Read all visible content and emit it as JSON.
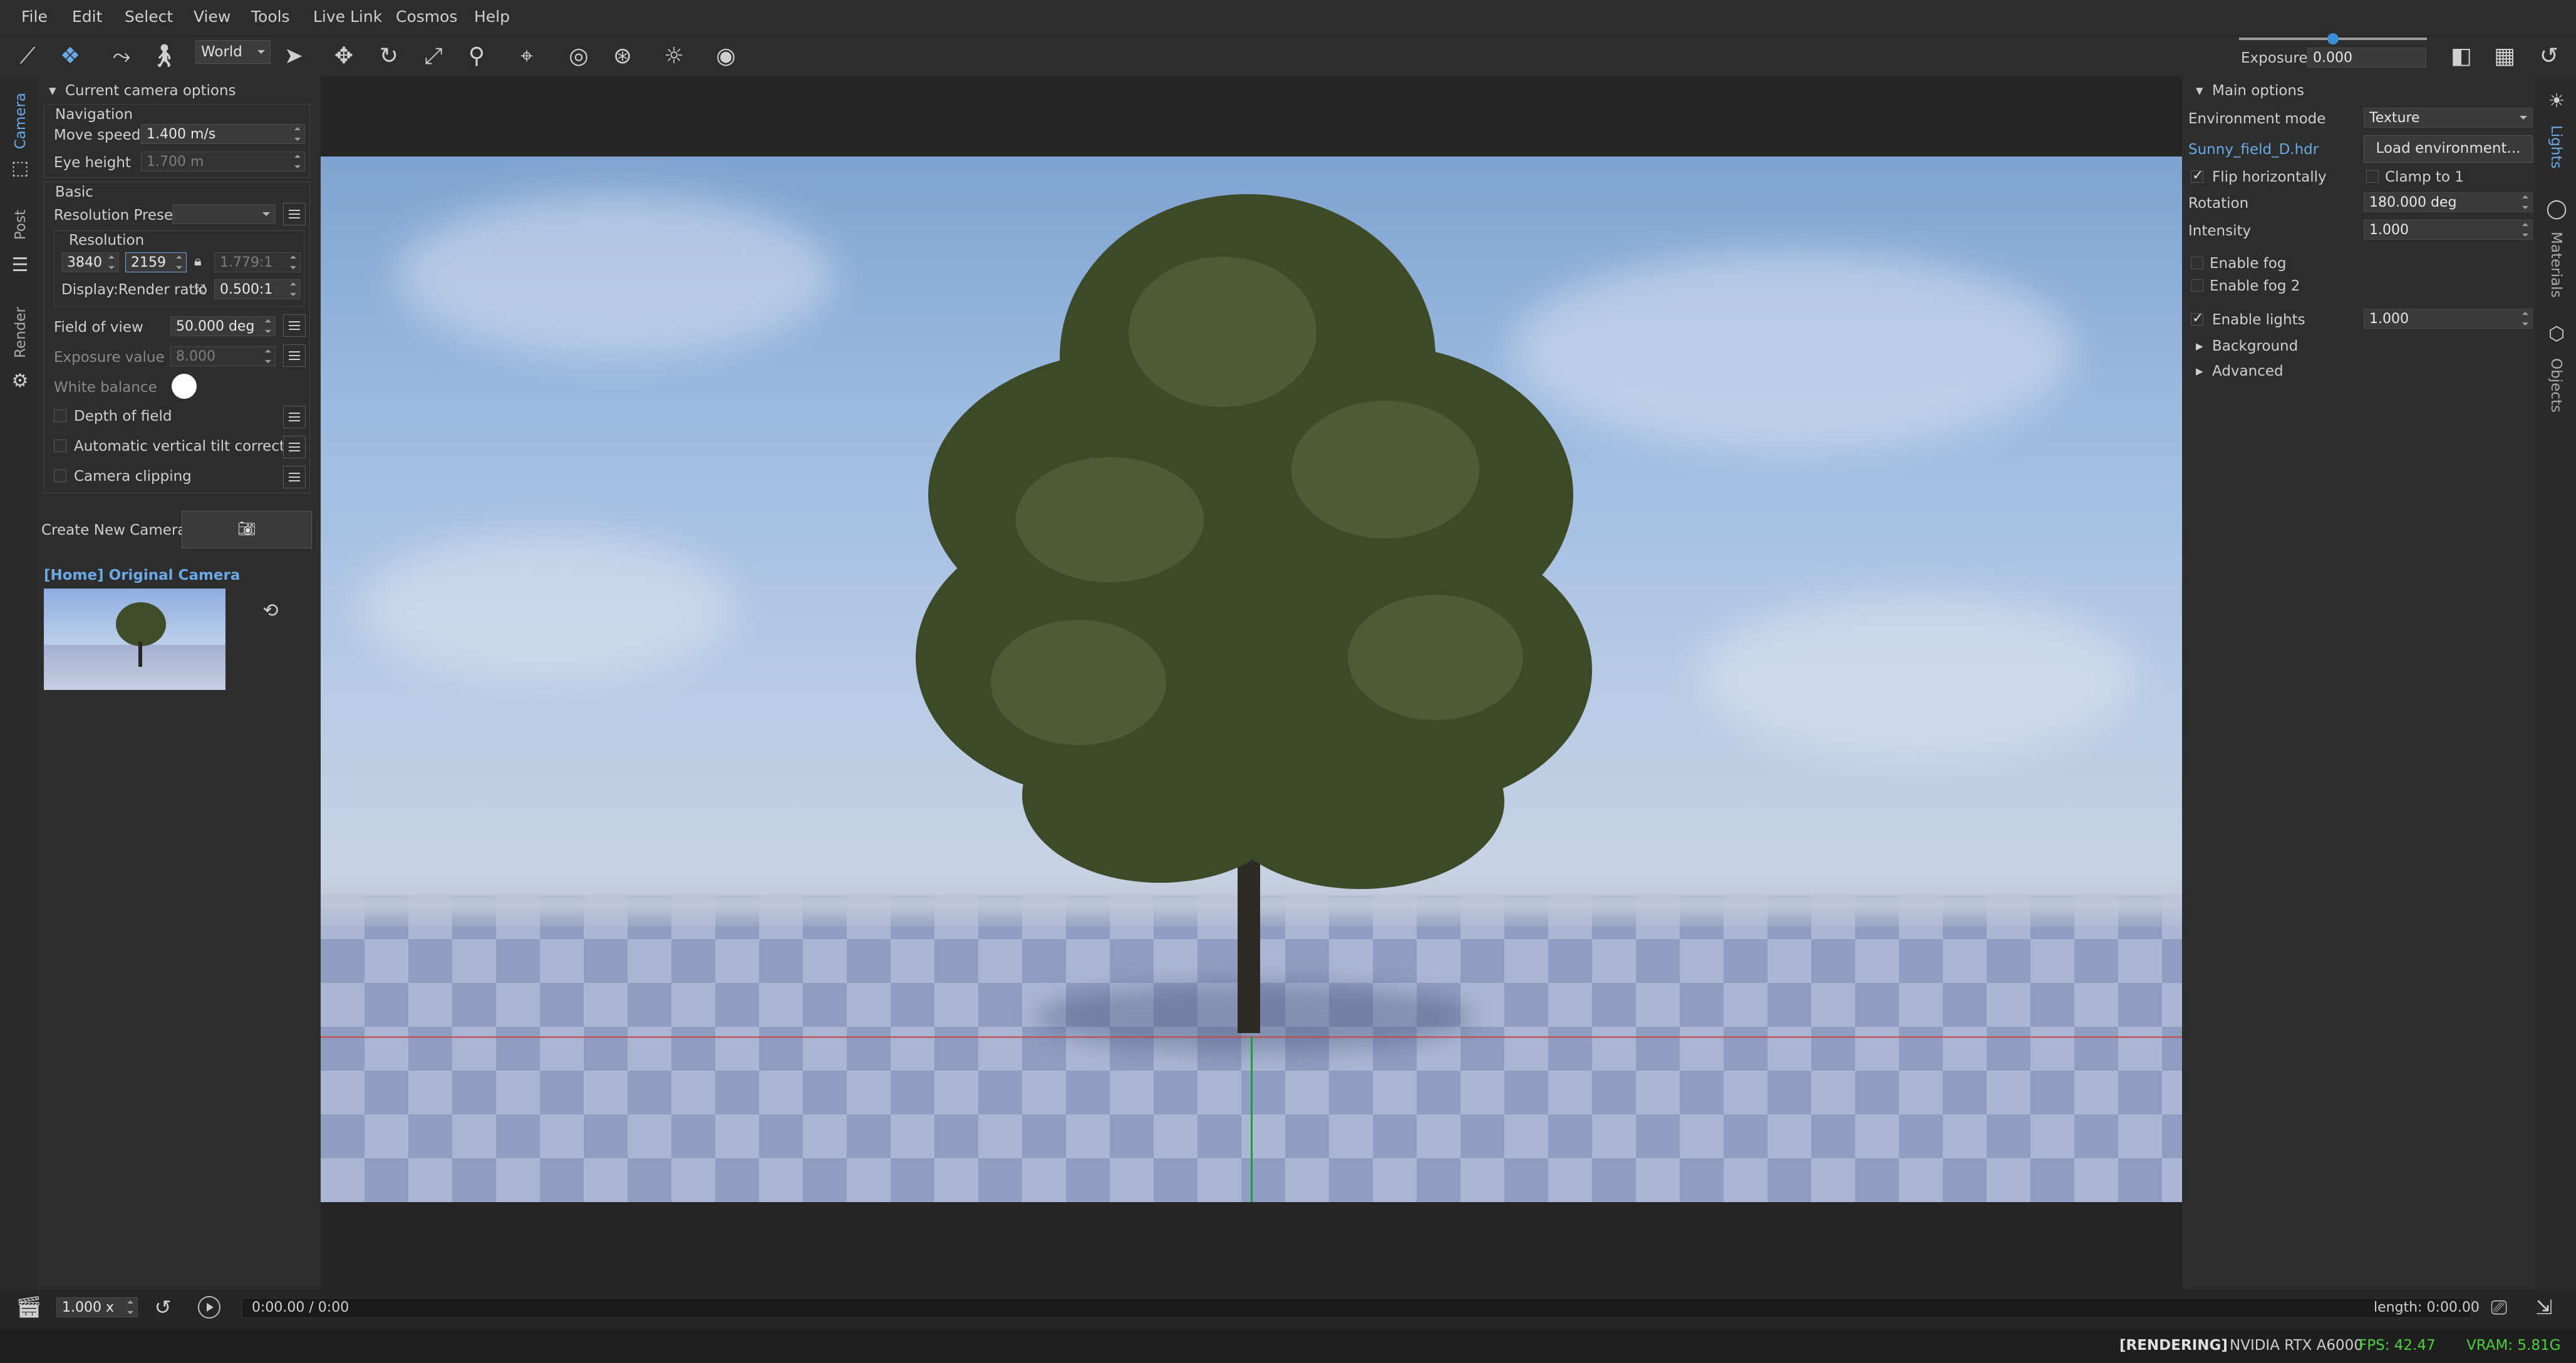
{
  "menu": [
    "File",
    "Edit",
    "Select",
    "View",
    "Tools",
    "Live Link",
    "Cosmos",
    "Help"
  ],
  "toolbar": {
    "space_mode": "World",
    "exposure_label": "Exposure",
    "exposure_value": "0.000"
  },
  "left_tabs": [
    "Camera",
    "Post",
    "Render"
  ],
  "camera_panel": {
    "section_title": "Current camera options",
    "navigation_title": "Navigation",
    "move_speed_label": "Move speed",
    "move_speed_value": "1.400 m/s",
    "eye_height_label": "Eye height",
    "eye_height_value": "1.700 m",
    "basic_title": "Basic",
    "resolution_preset_label": "Resolution Preset",
    "resolution_preset_value": "",
    "resolution_title": "Resolution",
    "res_width": "3840",
    "res_height": "2159",
    "aspect": "1.779:1",
    "display_render_ratio_label": "Display:Render ratio",
    "display_render_ratio_value": "0.500:1",
    "fov_label": "Field of view",
    "fov_value": "50.000 deg",
    "exposure_value_label": "Exposure value",
    "exposure_value_value": "8.000",
    "white_balance_label": "White balance",
    "depth_of_field_label": "Depth of field",
    "depth_of_field_checked": false,
    "auto_tilt_label": "Automatic vertical tilt correction",
    "auto_tilt_checked": false,
    "camera_clipping_label": "Camera clipping",
    "camera_clipping_checked": false,
    "create_camera_label": "Create New Camera",
    "camera_name": "[Home] Original Camera"
  },
  "right_tabs": [
    "Lights",
    "Materials",
    "Objects"
  ],
  "lights_panel": {
    "section_title": "Main options",
    "env_mode_label": "Environment mode",
    "env_mode_value": "Texture",
    "env_file": "Sunny_field_D.hdr",
    "load_env_label": "Load environment...",
    "flip_label": "Flip horizontally",
    "flip_checked": true,
    "clamp_label": "Clamp to 1",
    "clamp_checked": false,
    "rotation_label": "Rotation",
    "rotation_value": "180.000 deg",
    "intensity_label": "Intensity",
    "intensity_value": "1.000",
    "fog_label": "Enable fog",
    "fog_checked": false,
    "fog2_label": "Enable fog 2",
    "fog2_checked": false,
    "lights_label": "Enable lights",
    "lights_checked": true,
    "lights_value": "1.000",
    "background_label": "Background",
    "advanced_label": "Advanced"
  },
  "timeline": {
    "speed": "1.000 x",
    "time": "0:00.00 / 0:00",
    "length": "length: 0:00.00"
  },
  "status": {
    "state": "[RENDERING]",
    "gpu": "NVIDIA RTX A6000",
    "fps": "FPS:  42.47",
    "vram": "VRAM:  5.81G"
  },
  "colors": {
    "accent": "#3a8fd6",
    "link": "#6aa9e6",
    "fps_green": "#4cd13c",
    "bg": "#262626",
    "panel": "#2d2d2d"
  }
}
